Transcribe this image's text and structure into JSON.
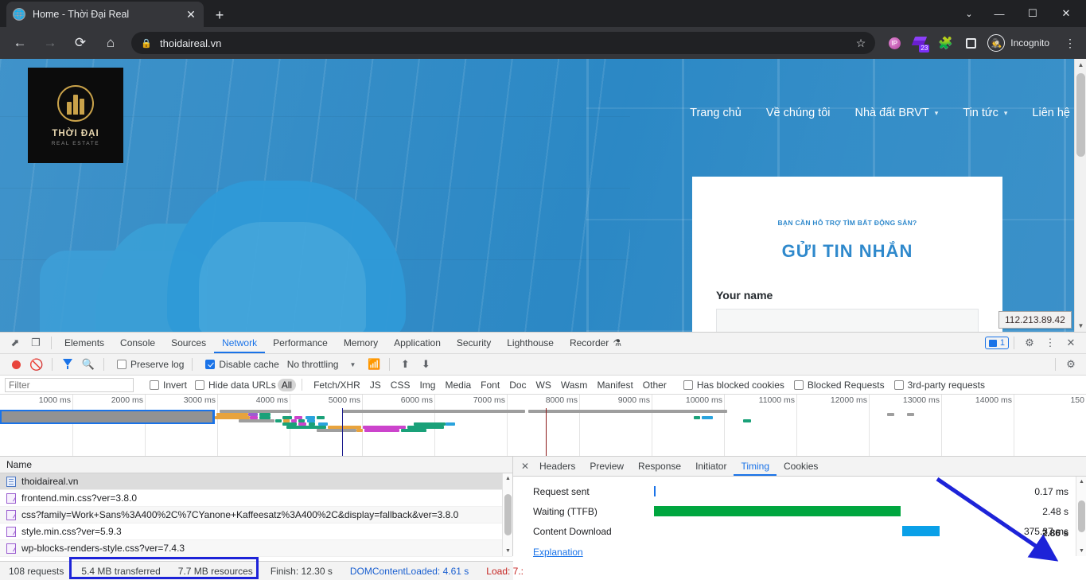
{
  "browser": {
    "tab": {
      "title": "Home - Thời Đại Real",
      "favicon": "globe-icon",
      "close": "✕"
    },
    "newtab_label": "+",
    "window": {
      "minimize": "—",
      "maximize": "☐",
      "close": "✕",
      "chevron": "⌄"
    },
    "nav": {
      "back": "←",
      "forward": "→",
      "reload": "⟳",
      "home": "⌂"
    },
    "omnibox": {
      "url": "thoidaireal.vn",
      "lock": "lock-icon",
      "star": "☆"
    },
    "toolbar_icons": {
      "extension_badge_count": "23",
      "puzzle": "puzzle-icon",
      "side_panel": "side-panel-icon",
      "menu": "⋮"
    },
    "profile": {
      "label": "Incognito"
    }
  },
  "page": {
    "logo": {
      "name": "THỜI ĐẠI",
      "sub": "REAL ESTATE"
    },
    "nav_items": [
      {
        "label": "Trang chủ",
        "has_caret": false
      },
      {
        "label": "Về chúng tôi",
        "has_caret": false
      },
      {
        "label": "Nhà đất BRVT",
        "has_caret": true
      },
      {
        "label": "Tin tức",
        "has_caret": true
      },
      {
        "label": "Liên hệ",
        "has_caret": false
      }
    ],
    "contact_card": {
      "eyebrow": "BẠN CẦN HỖ TRỢ TÌM BẤT ĐỘNG SẢN?",
      "title": "GỬI TIN NHẮN",
      "field_label": "Your name",
      "field_value": ""
    },
    "ip_tooltip": "112.213.89.42"
  },
  "devtools": {
    "panel_tabs": [
      {
        "label": "Elements",
        "active": false
      },
      {
        "label": "Console",
        "active": false
      },
      {
        "label": "Sources",
        "active": false
      },
      {
        "label": "Network",
        "active": true
      },
      {
        "label": "Performance",
        "active": false
      },
      {
        "label": "Memory",
        "active": false
      },
      {
        "label": "Application",
        "active": false
      },
      {
        "label": "Security",
        "active": false
      },
      {
        "label": "Lighthouse",
        "active": false
      },
      {
        "label": "Recorder",
        "active": false
      }
    ],
    "recorder_suffix": "⚗",
    "message_count": "1",
    "settings_icon": "gear-icon",
    "more_icon": "⋮",
    "close_icon": "✕",
    "network_controls": {
      "record": "record-button",
      "clear": "clear-button",
      "filter": "filter-icon",
      "search": "search-icon",
      "preserve_log": {
        "label": "Preserve log",
        "checked": false
      },
      "disable_cache": {
        "label": "Disable cache",
        "checked": true
      },
      "throttling": "No throttling",
      "import_label": "import-har-icon",
      "export_label": "export-har-icon"
    },
    "filter_bar": {
      "placeholder": "Filter",
      "value": "",
      "invert": {
        "label": "Invert",
        "checked": false
      },
      "hide_data_urls": {
        "label": "Hide data URLs",
        "checked": false
      },
      "types": [
        "All",
        "Fetch/XHR",
        "JS",
        "CSS",
        "Img",
        "Media",
        "Font",
        "Doc",
        "WS",
        "Wasm",
        "Manifest",
        "Other"
      ],
      "active_type": "All",
      "has_blocked_cookies": {
        "label": "Has blocked cookies",
        "checked": false
      },
      "blocked_requests": {
        "label": "Blocked Requests",
        "checked": false
      },
      "third_party": {
        "label": "3rd-party requests",
        "checked": false
      }
    },
    "overview": {
      "ticks": [
        "1000 ms",
        "2000 ms",
        "3000 ms",
        "4000 ms",
        "5000 ms",
        "6000 ms",
        "7000 ms",
        "8000 ms",
        "9000 ms",
        "10000 ms",
        "11000 ms",
        "12000 ms",
        "13000 ms",
        "14000 ms",
        "150"
      ]
    },
    "requests": {
      "column_header": "Name",
      "rows": [
        {
          "name": "thoidaireal.vn",
          "type": "doc",
          "selected": true
        },
        {
          "name": "frontend.min.css?ver=3.8.0",
          "type": "css",
          "selected": false
        },
        {
          "name": "css?family=Work+Sans%3A400%2C%7CYanone+Kaffeesatz%3A400%2C&display=fallback&ver=3.8.0",
          "type": "css",
          "selected": false
        },
        {
          "name": "style.min.css?ver=5.9.3",
          "type": "css",
          "selected": false
        },
        {
          "name": "wp-blocks-renders-style.css?ver=7.4.3",
          "type": "css",
          "selected": false
        }
      ]
    },
    "detail": {
      "tabs": [
        {
          "label": "Headers",
          "active": false
        },
        {
          "label": "Preview",
          "active": false
        },
        {
          "label": "Response",
          "active": false
        },
        {
          "label": "Initiator",
          "active": false
        },
        {
          "label": "Timing",
          "active": true
        },
        {
          "label": "Cookies",
          "active": false
        }
      ],
      "timing_rows": [
        {
          "label": "Request sent",
          "value": "0.17 ms",
          "color": "#1a73e8",
          "start_pct": 0.5,
          "width_pct": 0.4
        },
        {
          "label": "Waiting (TTFB)",
          "value": "2.48 s",
          "color": "#00a63f",
          "start_pct": 0.5,
          "width_pct": 67.5
        },
        {
          "label": "Content Download",
          "value": "375.37 ms",
          "color": "#0aa0e8",
          "start_pct": 68.5,
          "width_pct": 10.2
        }
      ],
      "explanation_link": "Explanation",
      "total": "2.86 s"
    },
    "status_bar": {
      "requests": "108 requests",
      "transferred": "5.4 MB transferred",
      "resources": "7.7 MB resources",
      "finish": "Finish: 12.30 s",
      "dom_content_loaded": "DOMContentLoaded: 4.61 s",
      "load": "Load: 7.:"
    }
  },
  "annotations": {
    "highlight_color": "#1d23d8",
    "arrow_color": "#1d23d8"
  }
}
